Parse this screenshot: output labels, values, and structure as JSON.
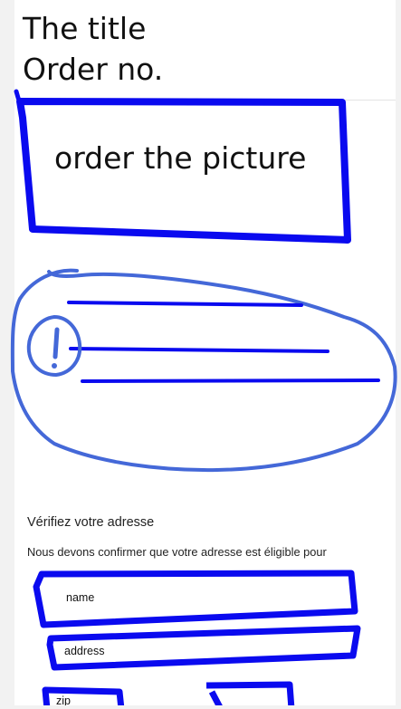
{
  "header": {
    "title": "The title",
    "order_no": "Order no."
  },
  "picture_placeholder": {
    "label": "order the picture"
  },
  "address_section": {
    "heading": "Vérifiez votre adresse",
    "description": "Nous devons confirmer que votre adresse est éligible pour"
  },
  "form": {
    "fields": [
      {
        "label": "name"
      },
      {
        "label": "address"
      },
      {
        "label": "zip"
      }
    ]
  },
  "colors": {
    "annotation_blue": "#0a0aef",
    "annotation_light_blue": "#4468d8",
    "page_background": "#ffffff"
  },
  "icons": {
    "alert": "exclamation-icon"
  }
}
